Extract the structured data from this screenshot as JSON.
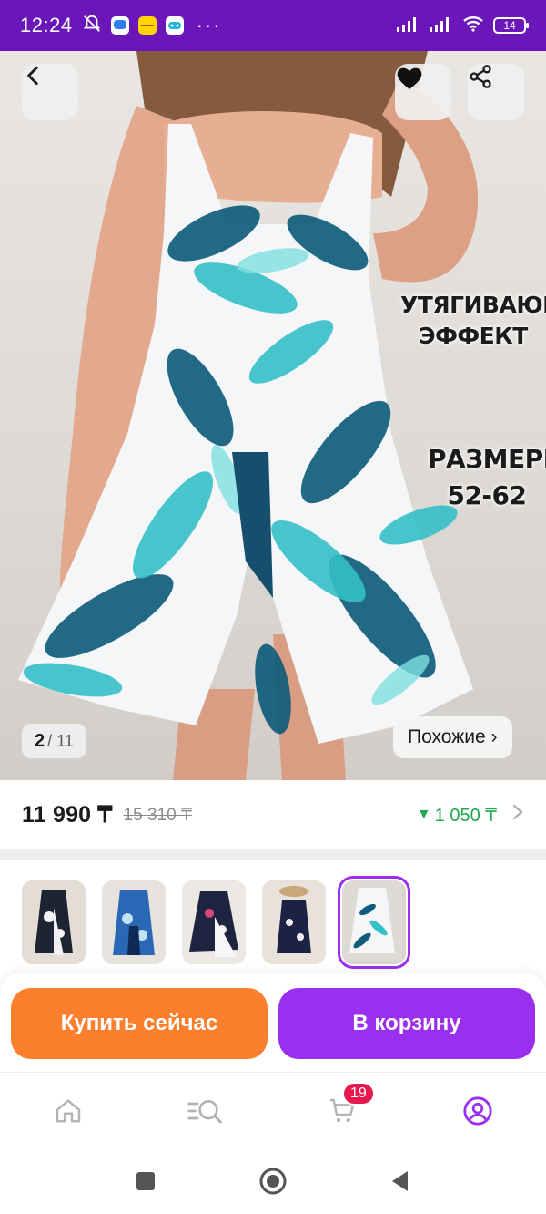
{
  "status_bar": {
    "time": "12:24",
    "app_icons": [
      "mute-notifications-icon",
      "messages-app-icon",
      "kaspi-app-icon",
      "games-app-icon"
    ],
    "more_indicator": "···",
    "battery": "14"
  },
  "hero": {
    "promo_line_1": "УТЯГИВАЮЩИЙ",
    "promo_line_2": "ЭФФЕКТ",
    "promo_line_3": "РАЗМЕРЫ",
    "promo_line_4": "52-62",
    "counter_current": "2",
    "counter_total": "/ 11",
    "similar_label": "Похожие ›"
  },
  "price": {
    "current": "11 990 ₸",
    "old": "15 310 ₸",
    "bonus": "1 050 ₸",
    "bonus_arrow": "▼"
  },
  "thumbnails": {
    "count": 5,
    "selected_index": 4
  },
  "actions": {
    "buy_now": "Купить сейчас",
    "add_to_cart": "В корзину"
  },
  "tab_bar": {
    "cart_badge": "19",
    "items": [
      "home-icon",
      "catalog-search-icon",
      "cart-icon",
      "profile-icon"
    ],
    "active_item": "profile-icon"
  },
  "colors": {
    "brand_purple": "#9a2ff0",
    "status_bar": "#6a16b8",
    "buy_orange": "#fb7f2c",
    "bonus_green": "#1fa84f",
    "badge_red": "#e8194e"
  }
}
